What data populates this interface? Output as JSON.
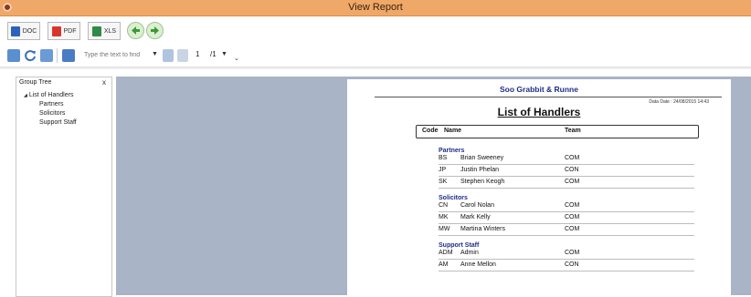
{
  "window": {
    "title": "View Report"
  },
  "export_toolbar": {
    "doc_label": "DOC",
    "pdf_label": "PDF",
    "xls_label": "XLS"
  },
  "viewer_toolbar": {
    "find_placeholder": "Type the text to find",
    "page_current": "1",
    "page_total": "/1"
  },
  "group_tree": {
    "title": "Group Tree",
    "close": "x",
    "root_label": "List of Handlers",
    "root_toggle": "◢",
    "items": [
      "Partners",
      "Solicitors",
      "Support Staff"
    ]
  },
  "report": {
    "company": "Soo Grabbit & Runne",
    "data_date": "Data Date : 24/08/2015 14:43",
    "title": "List of Handlers",
    "columns": {
      "code": "Code",
      "name": "Name",
      "team": "Team"
    },
    "groups": [
      {
        "name": "Partners",
        "rows": [
          {
            "code": "BS",
            "name": "Brian Sweeney",
            "team": "COM"
          },
          {
            "code": "JP",
            "name": "Justin Phelan",
            "team": "CON"
          },
          {
            "code": "SK",
            "name": "Stephen Keogh",
            "team": "COM"
          }
        ]
      },
      {
        "name": "Solicitors",
        "rows": [
          {
            "code": "CN",
            "name": "Carol Nolan",
            "team": "COM"
          },
          {
            "code": "MK",
            "name": "Mark Kelly",
            "team": "COM"
          },
          {
            "code": "MW",
            "name": "Martina Winters",
            "team": "COM"
          }
        ]
      },
      {
        "name": "Support Staff",
        "rows": [
          {
            "code": "ADM",
            "name": "Admin",
            "team": "COM"
          },
          {
            "code": "AM",
            "name": "Anne Mellon",
            "team": "CON"
          }
        ]
      }
    ]
  },
  "colors": {
    "titlebar": "#f0a868",
    "report_background": "#a9b4c6",
    "group_header": "#1f2d85"
  }
}
